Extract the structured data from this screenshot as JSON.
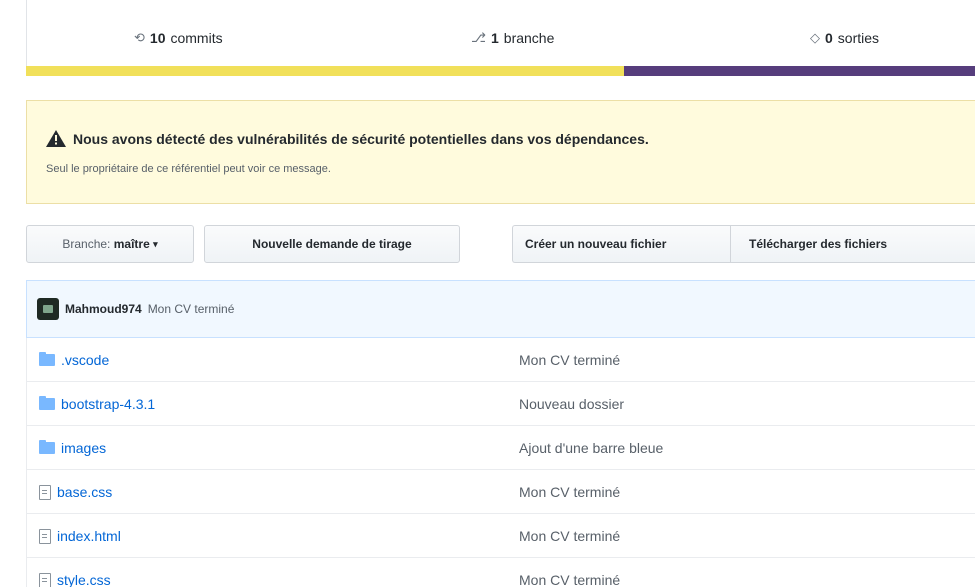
{
  "stats": {
    "commits": {
      "num": "10",
      "label": "commits",
      "icon": "history-icon"
    },
    "branches": {
      "num": "1",
      "label": "branche",
      "icon": "branch-icon"
    },
    "releases": {
      "num": "0",
      "label": "sorties",
      "icon": "tag-icon"
    }
  },
  "language_bar": [
    {
      "color": "#f1e05a",
      "percent": 63
    },
    {
      "color": "#563d7c",
      "percent": 37
    }
  ],
  "alert": {
    "title": "Nous avons détecté des vulnérabilités de sécurité potentielles dans vos dépendances.",
    "subtitle": "Seul le propriétaire de ce référentiel peut voir ce message."
  },
  "toolbar": {
    "branch_prefix": "Branche:",
    "branch_name": "maître",
    "new_pull_request": "Nouvelle demande de tirage",
    "create_file": "Créer un nouveau fichier",
    "upload_files": "Télécharger des fichiers"
  },
  "commit": {
    "author": "Mahmoud974",
    "message": "Mon CV terminé"
  },
  "files": [
    {
      "name": ".vscode",
      "type": "folder",
      "message": "Mon CV terminé"
    },
    {
      "name": "bootstrap-4.3.1",
      "type": "folder",
      "message": "Nouveau dossier"
    },
    {
      "name": "images",
      "type": "folder",
      "message": "Ajout d'une barre bleue"
    },
    {
      "name": "base.css",
      "type": "file",
      "message": "Mon CV terminé"
    },
    {
      "name": "index.html",
      "type": "file",
      "message": "Mon CV terminé"
    },
    {
      "name": "style.css",
      "type": "file",
      "message": "Mon CV terminé"
    }
  ]
}
